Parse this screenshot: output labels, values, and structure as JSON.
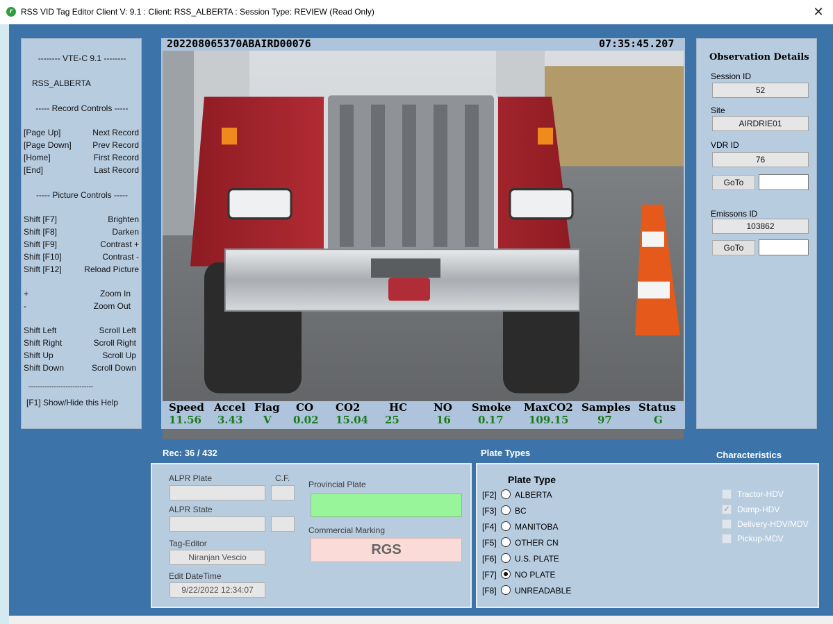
{
  "window": {
    "title": "RSS VID Tag Editor Client V: 9.1 :  Client: RSS_ALBERTA :  Session Type: REVIEW (Read Only)",
    "close_symbol": "✕",
    "icon": "app-logo-icon"
  },
  "help": {
    "version_line": "-------- VTE-C 9.1 --------",
    "client": "RSS_ALBERTA",
    "record_header": "----- Record Controls -----",
    "record_controls": [
      {
        "key": "[Page Up]",
        "action": "Next Record"
      },
      {
        "key": "[Page Down]",
        "action": "Prev Record"
      },
      {
        "key": "[Home]",
        "action": "First Record"
      },
      {
        "key": "[End]",
        "action": "Last Record"
      }
    ],
    "picture_header": "----- Picture Controls -----",
    "picture_controls": [
      {
        "key": "Shift [F7]",
        "action": "Brighten"
      },
      {
        "key": "Shift [F8]",
        "action": "Darken"
      },
      {
        "key": "Shift [F9]",
        "action": "Contrast +"
      },
      {
        "key": "Shift [F10]",
        "action": "Contrast -"
      },
      {
        "key": "Shift [F12]",
        "action": "Reload Picture"
      }
    ],
    "zoom_controls": [
      {
        "key": "+",
        "action": "Zoom In"
      },
      {
        "key": "-",
        "action": "Zoom Out"
      }
    ],
    "scroll_controls": [
      {
        "key": "Shift Left",
        "action": "Scroll Left"
      },
      {
        "key": "Shift Right",
        "action": "Scroll Right"
      },
      {
        "key": "Shift Up",
        "action": "Scroll Up"
      },
      {
        "key": "Shift Down",
        "action": "Scroll Down"
      }
    ],
    "divider": "----------------------------",
    "footer": "[F1] Show/Hide this Help"
  },
  "photo": {
    "record_id": "202208065370ABAIRD00076",
    "timestamp": "07:35:45.207"
  },
  "readings": {
    "headers": [
      "Speed",
      "Accel",
      "Flag",
      "CO",
      "CO2",
      "HC",
      "NO",
      "Smoke",
      "MaxCO2",
      "Samples",
      "Status"
    ],
    "values": [
      "11.56",
      "3.43",
      "V",
      "0.02",
      "15.04",
      "25",
      "16",
      "0.17",
      "109.15",
      "97",
      "G"
    ]
  },
  "observation": {
    "title": "Observation Details",
    "session_id_label": "Session ID",
    "session_id": "52",
    "site_label": "Site",
    "site": "AIRDRIE01",
    "vdr_id_label": "VDR ID",
    "vdr_id": "76",
    "goto_label": "GoTo",
    "emissions_id_label": "Emissons ID",
    "emissions_id": "103862"
  },
  "record": {
    "counter": "Rec: 36 / 432",
    "alpr_plate_label": "ALPR Plate",
    "cf_label": "C.F.",
    "alpr_state_label": "ALPR State",
    "tag_editor_label": "Tag-Editor",
    "tag_editor": "Niranjan Vescio",
    "edit_datetime_label": "Edit DateTime",
    "edit_datetime": "9/22/2022 12:34:07",
    "provincial_plate_label": "Provincial Plate",
    "commercial_marking_label": "Commercial Marking",
    "commercial_marking": "RGS",
    "provincial_plate_color": "#99f599"
  },
  "plate_types": {
    "section_label": "Plate Types",
    "title": "Plate Type",
    "options": [
      {
        "key": "[F2]",
        "label": "ALBERTA",
        "selected": false
      },
      {
        "key": "[F3]",
        "label": "BC",
        "selected": false
      },
      {
        "key": "[F4]",
        "label": "MANITOBA",
        "selected": false
      },
      {
        "key": "[F5]",
        "label": "OTHER CN",
        "selected": false
      },
      {
        "key": "[F6]",
        "label": "U.S. PLATE",
        "selected": false
      },
      {
        "key": "[F7]",
        "label": "NO PLATE",
        "selected": true
      },
      {
        "key": "[F8]",
        "label": "UNREADABLE",
        "selected": false
      }
    ]
  },
  "characteristics": {
    "section_label": "Characteristics",
    "items": [
      {
        "label": "Tractor-HDV",
        "checked": false
      },
      {
        "label": "Dump-HDV",
        "checked": true
      },
      {
        "label": "Delivery-HDV/MDV",
        "checked": false
      },
      {
        "label": "Pickup-MDV",
        "checked": false
      }
    ]
  },
  "colors": {
    "app_background": "#3c73a8",
    "panel": "#b8cce0",
    "readings_value": "#1a7a1a"
  }
}
